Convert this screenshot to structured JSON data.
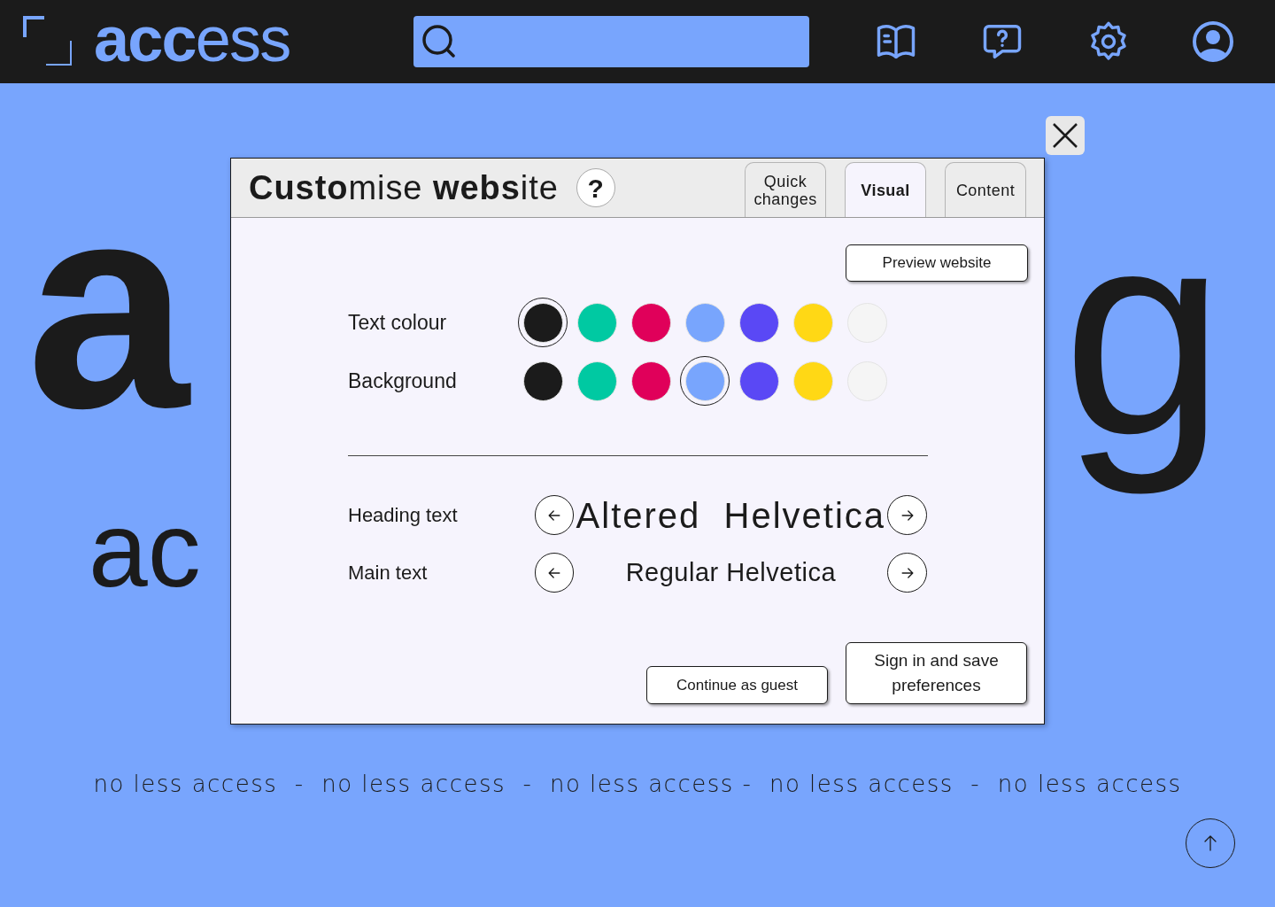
{
  "header": {
    "logo_bold": "acc",
    "logo_light": "ess"
  },
  "backdrop": {
    "big_left": "a",
    "big_right": "g",
    "small_left": "ac"
  },
  "dialog": {
    "title": "**Custo**mise **webs**ite",
    "help": "?",
    "tabs": [
      {
        "label": "Quick changes",
        "selected": false
      },
      {
        "label": "Visual",
        "selected": true
      },
      {
        "label": "Content",
        "selected": false
      }
    ],
    "preview_button": "Preview website",
    "colour_rows": [
      {
        "label": "Text colour",
        "swatches": [
          {
            "color": "#1b1b1b",
            "selected": true
          },
          {
            "color": "#00c9a2",
            "selected": false
          },
          {
            "color": "#e0005a",
            "selected": false
          },
          {
            "color": "#78a5fd",
            "selected": false
          },
          {
            "color": "#5a48f5",
            "selected": false
          },
          {
            "color": "#ffd815",
            "selected": false
          },
          {
            "color": "#f5f5f5",
            "selected": false
          }
        ]
      },
      {
        "label": "Background",
        "swatches": [
          {
            "color": "#1b1b1b",
            "selected": false
          },
          {
            "color": "#00c9a2",
            "selected": false
          },
          {
            "color": "#e0005a",
            "selected": false
          },
          {
            "color": "#78a5fd",
            "selected": true
          },
          {
            "color": "#5a48f5",
            "selected": false
          },
          {
            "color": "#ffd815",
            "selected": false
          },
          {
            "color": "#f5f5f5",
            "selected": false
          }
        ]
      }
    ],
    "font_rows": [
      {
        "label": "Heading text",
        "value": "Altered  Helvetica",
        "kind": "heading"
      },
      {
        "label": "Main text",
        "value": "Regular Helvetica",
        "kind": "main"
      }
    ],
    "guest_button": "Continue as guest",
    "save_button": "Sign in and save preferences"
  },
  "tagline": "no less access  -  no less access  -  no less access -  no less access  -  no less access"
}
